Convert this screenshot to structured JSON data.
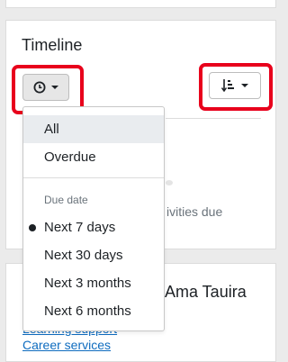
{
  "timeline": {
    "title": "Timeline",
    "filter_icon": "clock-icon",
    "sort_icon": "sort-amount-down-icon"
  },
  "dropdown": {
    "items": [
      {
        "label": "All",
        "active": true
      },
      {
        "label": "Overdue"
      }
    ],
    "section_header": "Due date",
    "date_options": [
      {
        "label": "Next 7 days",
        "selected": true
      },
      {
        "label": "Next 30 days"
      },
      {
        "label": "Next 3 months"
      },
      {
        "label": "Next 6 months"
      }
    ]
  },
  "background": {
    "empty_state_text": "ivities due",
    "user_name_partial": "Ama Tauira",
    "links": [
      "Learning support",
      "Career services"
    ]
  },
  "colors": {
    "highlight": "#e8001c",
    "link": "#0f6cbf"
  }
}
